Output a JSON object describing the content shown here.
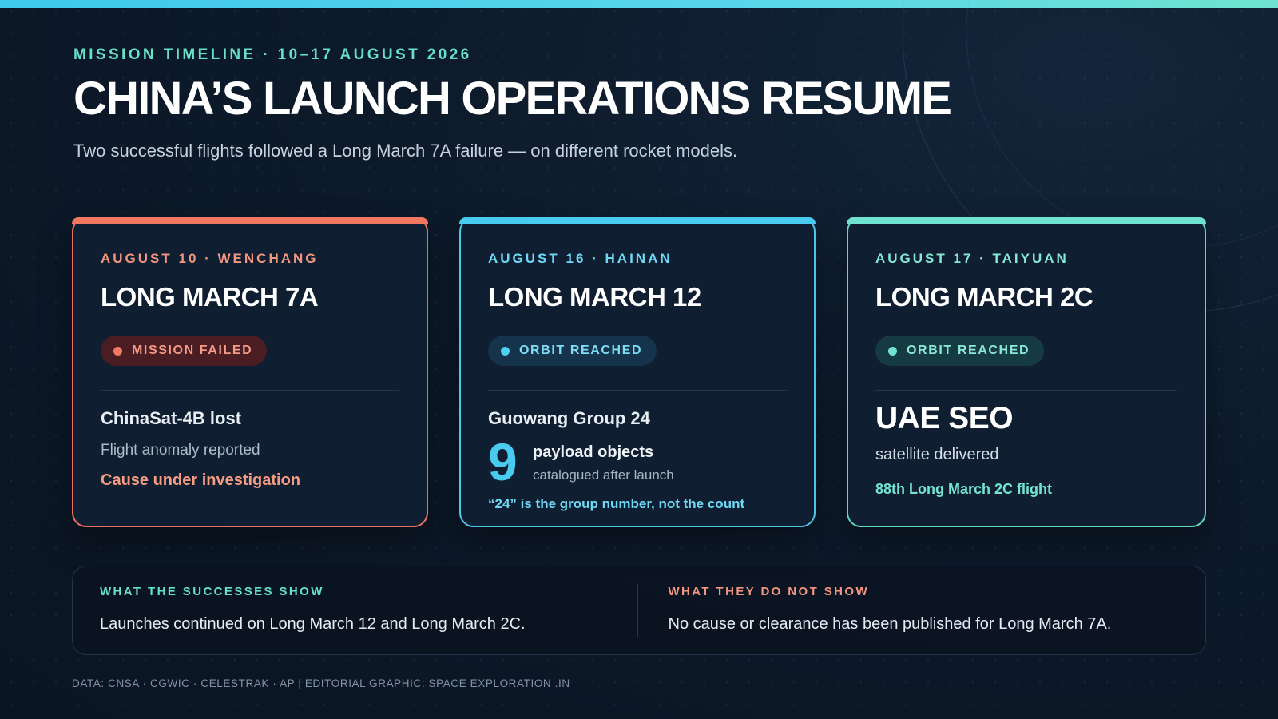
{
  "header": {
    "eyebrow": "MISSION TIMELINE · 10–17 AUGUST 2026",
    "title": "CHINA’S LAUNCH OPERATIONS RESUME",
    "subtitle": "Two successful flights followed a Long March 7A failure — on different rocket models."
  },
  "launches": [
    {
      "date_site": "AUGUST 10 · WENCHANG",
      "rocket": "LONG MARCH 7A",
      "status": "MISSION FAILED",
      "payload": "ChinaSat-4B lost",
      "note": "Flight anomaly reported",
      "detail": "Cause under investigation",
      "accent_color": "#f07860"
    },
    {
      "date_site": "AUGUST 16 · HAINAN",
      "rocket": "LONG MARCH 12",
      "status": "ORBIT REACHED",
      "payload": "Guowang Group 24",
      "count": "9",
      "count_label": "payload objects",
      "count_sub": "catalogued after launch",
      "detail": "“24” is the group number, not the count",
      "accent_color": "#49cbef"
    },
    {
      "date_site": "AUGUST 17 · TAIYUAN",
      "rocket": "LONG MARCH 2C",
      "status": "ORBIT REACHED",
      "payload": "UAE SEO",
      "note": "satellite delivered",
      "detail": "88th Long March 2C flight",
      "accent_color": "#6fe3cf"
    }
  ],
  "findings": {
    "shows_label": "WHAT THE SUCCESSES SHOW",
    "shows_text": "Launches continued on Long March 12 and Long March 2C.",
    "not_label": "WHAT THEY DO NOT SHOW",
    "not_text": "No cause or clearance has been published for Long March 7A."
  },
  "footer": "DATA: CNSA · CGWIC · CELESTRAK · AP | EDITORIAL GRAPHIC: SPACE EXPLORATION .IN"
}
